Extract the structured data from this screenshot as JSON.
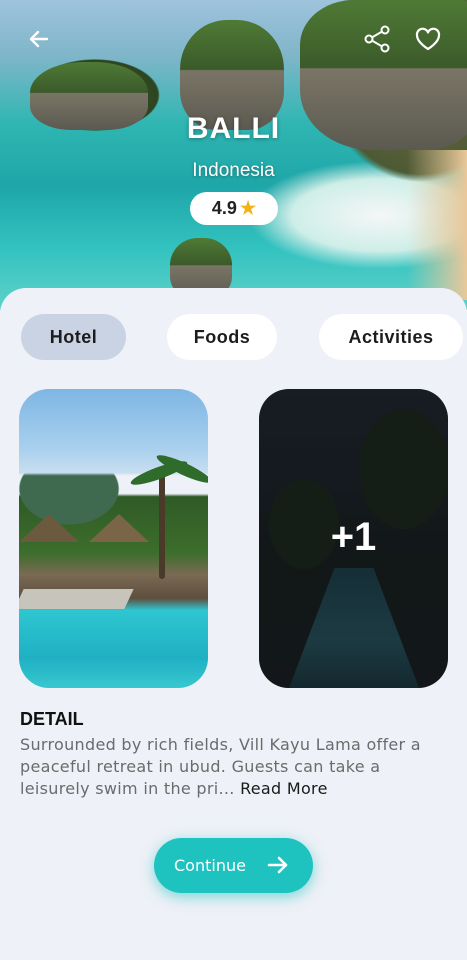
{
  "header": {
    "back_icon": "arrow-left-icon",
    "share_icon": "share-icon",
    "favorite_icon": "heart-icon",
    "title": "BALLI",
    "subtitle": "Indonesia",
    "rating": "4.9",
    "rating_icon": "star-icon",
    "star_color": "#f2b21a"
  },
  "tabs": [
    {
      "label": "Hotel",
      "active": true
    },
    {
      "label": "Foods",
      "active": false
    },
    {
      "label": "Activities",
      "active": false
    }
  ],
  "gallery": {
    "more_count": "+1"
  },
  "detail": {
    "heading": "DETAIL",
    "text": "Surrounded by rich fields, Vill Kayu Lama offer a peaceful retreat in ubud. Guests can take a leisurely swim in the pri...",
    "read_more": "Read More"
  },
  "cta": {
    "label": "Continue",
    "icon": "arrow-right-icon",
    "color": "#1ec3c0"
  }
}
